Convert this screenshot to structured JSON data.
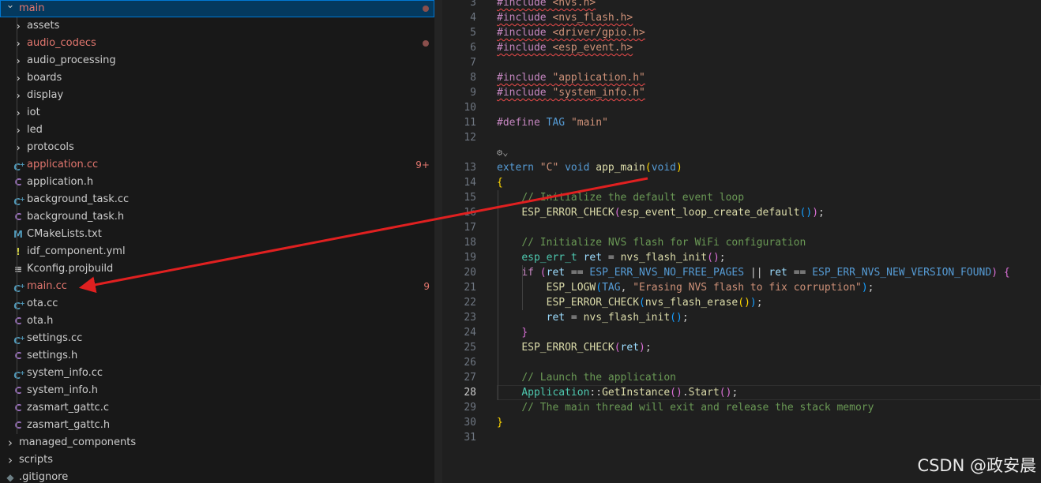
{
  "explorer": {
    "root": {
      "label": "main"
    },
    "items": [
      {
        "label": "assets",
        "kind": "folder"
      },
      {
        "label": "audio_codecs",
        "kind": "folder",
        "modified": true
      },
      {
        "label": "audio_processing",
        "kind": "folder"
      },
      {
        "label": "boards",
        "kind": "folder"
      },
      {
        "label": "display",
        "kind": "folder"
      },
      {
        "label": "iot",
        "kind": "folder"
      },
      {
        "label": "led",
        "kind": "folder"
      },
      {
        "label": "protocols",
        "kind": "folder"
      },
      {
        "label": "application.cc",
        "kind": "cpp",
        "icon": "C+",
        "modified": true,
        "badge": "9+"
      },
      {
        "label": "application.h",
        "kind": "hdr",
        "icon": "C"
      },
      {
        "label": "background_task.cc",
        "kind": "cpp",
        "icon": "C+"
      },
      {
        "label": "background_task.h",
        "kind": "hdr",
        "icon": "C"
      },
      {
        "label": "CMakeLists.txt",
        "kind": "mk",
        "icon": "M"
      },
      {
        "label": "idf_component.yml",
        "kind": "yml",
        "icon": "!"
      },
      {
        "label": "Kconfig.projbuild",
        "kind": "cfg",
        "icon": "≡"
      },
      {
        "label": "main.cc",
        "kind": "cpp",
        "icon": "C+",
        "modified": true,
        "badge": "9"
      },
      {
        "label": "ota.cc",
        "kind": "cpp",
        "icon": "C+"
      },
      {
        "label": "ota.h",
        "kind": "hdr",
        "icon": "C"
      },
      {
        "label": "settings.cc",
        "kind": "cpp",
        "icon": "C+"
      },
      {
        "label": "settings.h",
        "kind": "hdr",
        "icon": "C"
      },
      {
        "label": "system_info.cc",
        "kind": "cpp",
        "icon": "C+"
      },
      {
        "label": "system_info.h",
        "kind": "hdr",
        "icon": "C"
      },
      {
        "label": "zasmart_gattc.c",
        "kind": "hdr",
        "icon": "C"
      },
      {
        "label": "zasmart_gattc.h",
        "kind": "hdr",
        "icon": "C"
      }
    ],
    "siblings": [
      {
        "label": "managed_components",
        "kind": "folder"
      },
      {
        "label": "scripts",
        "kind": "folder"
      },
      {
        "label": ".gitignore",
        "kind": "git",
        "icon": "◆"
      }
    ]
  },
  "editor": {
    "current_line": 28,
    "codelens_icon": "copilot-icon",
    "lines": [
      {
        "n": "3",
        "tokens": [
          {
            "t": "#include",
            "c": "pp",
            "sq": true
          },
          {
            "t": " <nvs.h>",
            "c": "str",
            "sq": true
          }
        ]
      },
      {
        "n": "4",
        "tokens": [
          {
            "t": "#include",
            "c": "pp",
            "sq": true
          },
          {
            "t": " <nvs_flash.h>",
            "c": "str",
            "sq": true
          }
        ]
      },
      {
        "n": "5",
        "tokens": [
          {
            "t": "#include",
            "c": "pp",
            "sq": true
          },
          {
            "t": " <driver/gpio.h>",
            "c": "str",
            "sq": true
          }
        ]
      },
      {
        "n": "6",
        "tokens": [
          {
            "t": "#include",
            "c": "pp",
            "sq": true
          },
          {
            "t": " <esp_event.h>",
            "c": "str",
            "sq": true
          }
        ]
      },
      {
        "n": "7",
        "tokens": []
      },
      {
        "n": "8",
        "tokens": [
          {
            "t": "#include",
            "c": "pp",
            "sq": true
          },
          {
            "t": " \"application.h\"",
            "c": "str",
            "sq": true
          }
        ]
      },
      {
        "n": "9",
        "tokens": [
          {
            "t": "#include",
            "c": "pp",
            "sq": true
          },
          {
            "t": " \"system_info.h\"",
            "c": "str",
            "sq": true
          }
        ]
      },
      {
        "n": "10",
        "tokens": []
      },
      {
        "n": "11",
        "tokens": [
          {
            "t": "#define",
            "c": "pp"
          },
          {
            "t": " "
          },
          {
            "t": "TAG",
            "c": "mac"
          },
          {
            "t": " "
          },
          {
            "t": "\"main\"",
            "c": "str"
          }
        ]
      },
      {
        "n": "12",
        "tokens": []
      },
      {
        "n": "",
        "codelens": true,
        "tokens": []
      },
      {
        "n": "13",
        "tokens": [
          {
            "t": "extern",
            "c": "kw"
          },
          {
            "t": " "
          },
          {
            "t": "\"C\"",
            "c": "str"
          },
          {
            "t": " "
          },
          {
            "t": "void",
            "c": "kw"
          },
          {
            "t": " "
          },
          {
            "t": "app_main",
            "c": "fn"
          },
          {
            "t": "(",
            "c": "br1"
          },
          {
            "t": "void",
            "c": "kw"
          },
          {
            "t": ")",
            "c": "br1"
          }
        ]
      },
      {
        "n": "14",
        "tokens": [
          {
            "t": "{",
            "c": "br1"
          }
        ]
      },
      {
        "n": "15",
        "tokens": [
          {
            "t": "    "
          },
          {
            "t": "// Initialize the default event loop",
            "c": "cm"
          }
        ]
      },
      {
        "n": "16",
        "tokens": [
          {
            "t": "    "
          },
          {
            "t": "ESP_ERROR_CHECK",
            "c": "fn"
          },
          {
            "t": "(",
            "c": "br2"
          },
          {
            "t": "esp_event_loop_create_default",
            "c": "fn"
          },
          {
            "t": "()",
            "c": "br3"
          },
          {
            "t": ")",
            "c": "br2"
          },
          {
            "t": ";"
          }
        ]
      },
      {
        "n": "17",
        "tokens": []
      },
      {
        "n": "18",
        "tokens": [
          {
            "t": "    "
          },
          {
            "t": "// Initialize NVS flash for WiFi configuration",
            "c": "cm"
          }
        ]
      },
      {
        "n": "19",
        "tokens": [
          {
            "t": "    "
          },
          {
            "t": "esp_err_t",
            "c": "cls"
          },
          {
            "t": " "
          },
          {
            "t": "ret",
            "c": "var"
          },
          {
            "t": " = "
          },
          {
            "t": "nvs_flash_init",
            "c": "fn"
          },
          {
            "t": "()",
            "c": "br2"
          },
          {
            "t": ";"
          }
        ]
      },
      {
        "n": "20",
        "tokens": [
          {
            "t": "    "
          },
          {
            "t": "if",
            "c": "pp"
          },
          {
            "t": " "
          },
          {
            "t": "(",
            "c": "br2"
          },
          {
            "t": "ret",
            "c": "var"
          },
          {
            "t": " == "
          },
          {
            "t": "ESP_ERR_NVS_NO_FREE_PAGES",
            "c": "mac"
          },
          {
            "t": " || "
          },
          {
            "t": "ret",
            "c": "var"
          },
          {
            "t": " == "
          },
          {
            "t": "ESP_ERR_NVS_NEW_VERSION_FOUND",
            "c": "mac"
          },
          {
            "t": ")",
            "c": "br2"
          },
          {
            "t": " "
          },
          {
            "t": "{",
            "c": "br2"
          }
        ]
      },
      {
        "n": "21",
        "tokens": [
          {
            "t": "        "
          },
          {
            "t": "ESP_LOGW",
            "c": "fn"
          },
          {
            "t": "(",
            "c": "br3"
          },
          {
            "t": "TAG",
            "c": "mac"
          },
          {
            "t": ", "
          },
          {
            "t": "\"Erasing NVS flash to fix corruption\"",
            "c": "str"
          },
          {
            "t": ")",
            "c": "br3"
          },
          {
            "t": ";"
          }
        ]
      },
      {
        "n": "22",
        "tokens": [
          {
            "t": "        "
          },
          {
            "t": "ESP_ERROR_CHECK",
            "c": "fn"
          },
          {
            "t": "(",
            "c": "br3"
          },
          {
            "t": "nvs_flash_erase",
            "c": "fn"
          },
          {
            "t": "()",
            "c": "br1"
          },
          {
            "t": ")",
            "c": "br3"
          },
          {
            "t": ";"
          }
        ]
      },
      {
        "n": "23",
        "tokens": [
          {
            "t": "        "
          },
          {
            "t": "ret",
            "c": "var"
          },
          {
            "t": " = "
          },
          {
            "t": "nvs_flash_init",
            "c": "fn"
          },
          {
            "t": "()",
            "c": "br3"
          },
          {
            "t": ";"
          }
        ]
      },
      {
        "n": "24",
        "tokens": [
          {
            "t": "    "
          },
          {
            "t": "}",
            "c": "br2"
          }
        ]
      },
      {
        "n": "25",
        "tokens": [
          {
            "t": "    "
          },
          {
            "t": "ESP_ERROR_CHECK",
            "c": "fn"
          },
          {
            "t": "(",
            "c": "br2"
          },
          {
            "t": "ret",
            "c": "var"
          },
          {
            "t": ")",
            "c": "br2"
          },
          {
            "t": ";"
          }
        ]
      },
      {
        "n": "26",
        "tokens": []
      },
      {
        "n": "27",
        "tokens": [
          {
            "t": "    "
          },
          {
            "t": "// Launch the application",
            "c": "cm"
          }
        ]
      },
      {
        "n": "28",
        "tokens": [
          {
            "t": "    "
          },
          {
            "t": "Application",
            "c": "cls"
          },
          {
            "t": "::"
          },
          {
            "t": "GetInstance",
            "c": "fn"
          },
          {
            "t": "()",
            "c": "br2"
          },
          {
            "t": "."
          },
          {
            "t": "Start",
            "c": "fn"
          },
          {
            "t": "()",
            "c": "br2"
          },
          {
            "t": ";"
          }
        ]
      },
      {
        "n": "29",
        "tokens": [
          {
            "t": "    "
          },
          {
            "t": "// The main thread will exit and release the stack memory",
            "c": "cm"
          }
        ]
      },
      {
        "n": "30",
        "tokens": [
          {
            "t": "}",
            "c": "br1"
          }
        ]
      },
      {
        "n": "31",
        "tokens": []
      }
    ]
  },
  "watermark": {
    "text": "CSDN @政安晨"
  },
  "annotation": {
    "color": "#e02020",
    "target": "main.cc"
  }
}
